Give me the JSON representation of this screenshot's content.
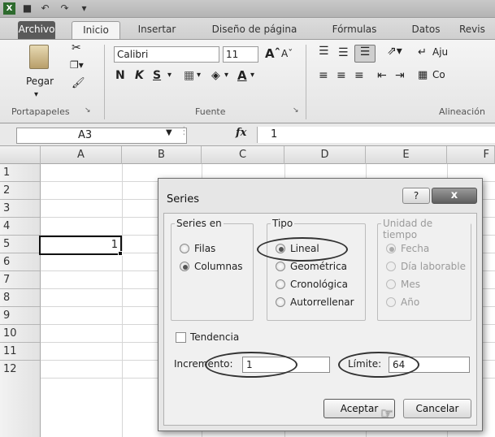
{
  "ribbon_tabs": [
    "Archivo",
    "Inicio",
    "Insertar",
    "Diseño de página",
    "Fórmulas",
    "Datos",
    "Revis"
  ],
  "ribbon": {
    "paste_label": "Pegar",
    "clipboard_group": "Portapapeles",
    "font_name": "Calibri",
    "font_size": "11",
    "bold": "N",
    "italic": "K",
    "underline": "S",
    "font_group": "Fuente",
    "alignment_group": "Alineación",
    "wrap_label": "Aju",
    "merge_label": "Co"
  },
  "formula_bar": {
    "name_box": "A3",
    "fx": "fx",
    "value": "1"
  },
  "grid": {
    "columns": [
      "A",
      "B",
      "C",
      "D",
      "E",
      "F"
    ],
    "rows": [
      "1",
      "2",
      "3",
      "4",
      "5",
      "6",
      "7",
      "8",
      "9",
      "10",
      "11",
      "12"
    ],
    "cell_a3": "1"
  },
  "dialog": {
    "title": "Series",
    "help": "?",
    "close": "x",
    "series_en": {
      "label": "Series en",
      "options": [
        "Filas",
        "Columnas"
      ],
      "selected": "Columnas"
    },
    "tipo": {
      "label": "Tipo",
      "options": [
        "Lineal",
        "Geométrica",
        "Cronológica",
        "Autorrellenar"
      ],
      "selected": "Lineal"
    },
    "unidad": {
      "label": "Unidad de tiempo",
      "options": [
        "Fecha",
        "Día laborable",
        "Mes",
        "Año"
      ],
      "selected": "Fecha"
    },
    "tendencia": "Tendencia",
    "incremento_label": "Incremento:",
    "incremento_value": "1",
    "limite_label": "Límite:",
    "limite_value": "64",
    "ok": "Aceptar",
    "cancel": "Cancelar"
  }
}
